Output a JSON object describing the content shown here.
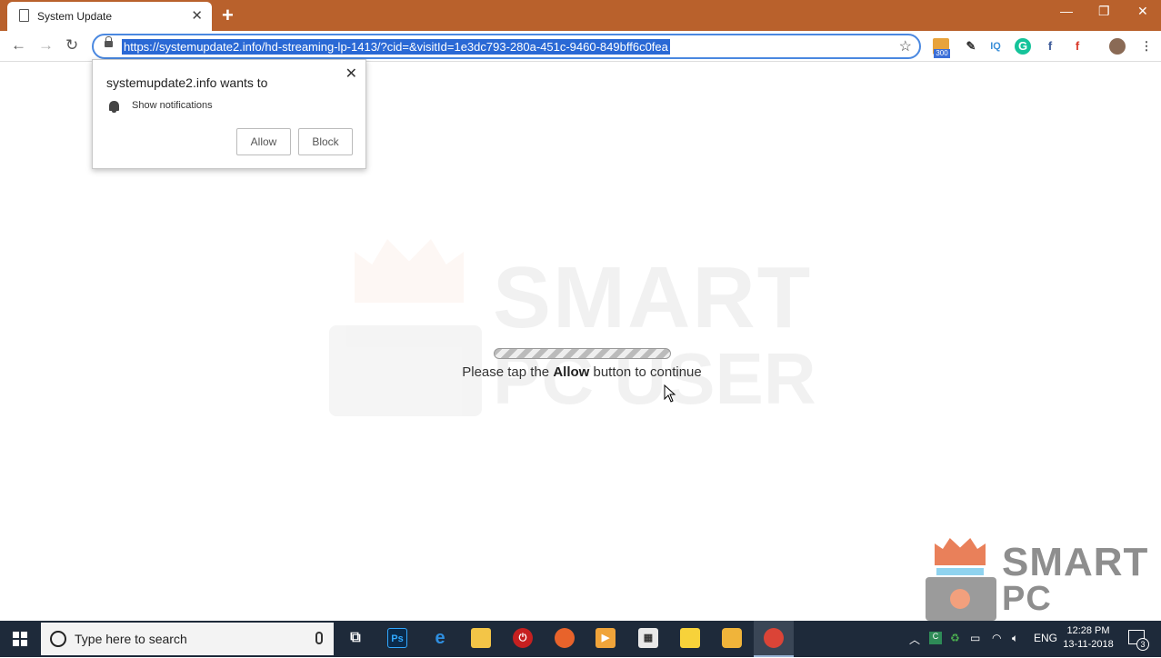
{
  "browser": {
    "tab_title": "System Update",
    "url": "https://systemupdate2.info/hd-streaming-lp-1413/?cid=&visitId=1e3dc793-280a-451c-9460-849bff6c0fea",
    "new_tab_label": "+",
    "window_controls": {
      "minimize": "—",
      "restore": "❐",
      "close": "✕"
    },
    "ext_badge_count": "300"
  },
  "permission_popup": {
    "title": "systemupdate2.info wants to",
    "permission": "Show notifications",
    "allow_label": "Allow",
    "block_label": "Block"
  },
  "page": {
    "msg_prefix": "Please tap the ",
    "msg_bold": "Allow",
    "msg_suffix": " button to continue"
  },
  "watermark": {
    "line1": "SMART",
    "line2": "PC USER"
  },
  "taskbar": {
    "search_placeholder": "Type here to search",
    "lang": "ENG",
    "time": "12:28 PM",
    "date": "13-11-2018",
    "notification_count": "3"
  },
  "colors": {
    "titlebar": "#b9612c",
    "url_selection": "#2a69d5",
    "taskbar": "#1e2a3a"
  }
}
